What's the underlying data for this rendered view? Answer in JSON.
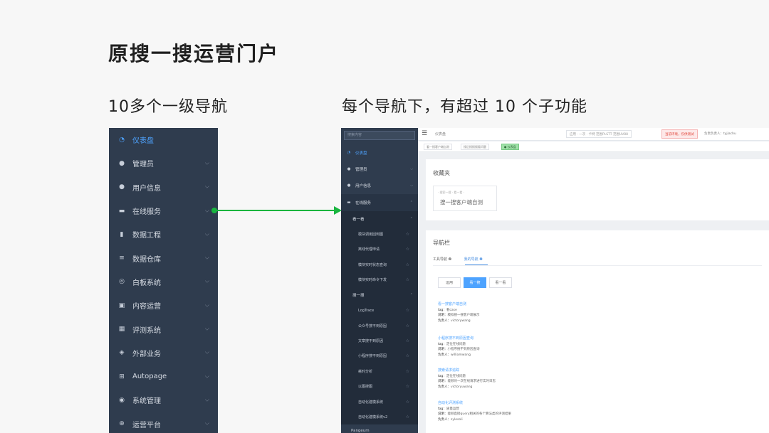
{
  "slide": {
    "title": "原搜一搜运营门户",
    "left_caption": "10多个一级导航",
    "right_caption": "每个导航下，有超过 10 个子功能"
  },
  "big_nav": [
    {
      "label": "仪表盘",
      "icon": "dashboard-icon",
      "glyph": "◔",
      "active": true,
      "chevron": false
    },
    {
      "label": "管理员",
      "icon": "user-icon",
      "glyph": "●",
      "active": false,
      "chevron": true
    },
    {
      "label": "用户信息",
      "icon": "user-icon",
      "glyph": "●",
      "active": false,
      "chevron": true
    },
    {
      "label": "在线服务",
      "icon": "chat-icon",
      "glyph": "▬",
      "active": false,
      "chevron": true
    },
    {
      "label": "数据工程",
      "icon": "document-icon",
      "glyph": "▮",
      "active": false,
      "chevron": true
    },
    {
      "label": "数据仓库",
      "icon": "database-icon",
      "glyph": "≡",
      "active": false,
      "chevron": true
    },
    {
      "label": "白板系统",
      "icon": "gauge-icon",
      "glyph": "◎",
      "active": false,
      "chevron": true
    },
    {
      "label": "内容运营",
      "icon": "robot-icon",
      "glyph": "▣",
      "active": false,
      "chevron": true
    },
    {
      "label": "评测系统",
      "icon": "table-icon",
      "glyph": "▦",
      "active": false,
      "chevron": true
    },
    {
      "label": "外部业务",
      "icon": "shield-icon",
      "glyph": "◈",
      "active": false,
      "chevron": true
    },
    {
      "label": "Autopage",
      "icon": "grid-icon",
      "glyph": "⊞",
      "active": false,
      "chevron": true
    },
    {
      "label": "系统管理",
      "icon": "eye-icon",
      "glyph": "◉",
      "active": false,
      "chevron": true
    },
    {
      "label": "运营平台",
      "icon": "plus-circle-icon",
      "glyph": "⊕",
      "active": false,
      "chevron": true
    }
  ],
  "app": {
    "search_placeholder": "搜索内容",
    "sidebar_top": [
      {
        "label": "仪表盘",
        "icon": "dashboard-icon",
        "glyph": "◔",
        "active": true,
        "chevron": false
      },
      {
        "label": "管理员",
        "icon": "user-icon",
        "glyph": "●",
        "active": false,
        "chevron": true
      },
      {
        "label": "用户信息",
        "icon": "user-icon",
        "glyph": "●",
        "active": false,
        "chevron": true
      },
      {
        "label": "在线服务",
        "icon": "chat-icon",
        "glyph": "▬",
        "active": false,
        "chevron": true
      }
    ],
    "groups": [
      {
        "label": "看一看",
        "items": [
          "模块调用回到图",
          "离线代理申请",
          "模块实时状态查询",
          "模块实时命令下发"
        ]
      },
      {
        "label": "搜一搜",
        "items": [
          "LogTrace",
          "公众号搜不到原因",
          "文章搜不到原因",
          "小程序搜不到原因",
          "耗时分析",
          "以图搜图",
          "自动化建模系统",
          "自动化建模系统v2"
        ]
      }
    ],
    "sidebar_bottom": "Pangeum",
    "topbar": {
      "title": "仪表盘",
      "links": "应用 · 一次 · 卡特    范围PLSTT    范围UV88",
      "warning": "当前环境，仅供测试",
      "user": "负责负责人：tyjiachu"
    },
    "tabs": [
      "看一搜客户端自测",
      "搜后搜搜搜看问题",
      "● 仪表盘"
    ],
    "favorites": {
      "heading": "收藏夹",
      "tagline": "· 搜索一搜 · 看一看 ·",
      "item": "搜一搜客户端自测"
    },
    "navbar": {
      "heading": "导航栏",
      "tabs": [
        "工具导航 ❷",
        "我的导航 ❷"
      ],
      "segments": [
        "运用",
        "看一搜",
        "看一看"
      ],
      "entries": [
        {
          "title": "看一搜客户端自测",
          "tag": "看case",
          "desc": "模拟搜一搜客户端展示",
          "owner": "victorywang"
        },
        {
          "title": "小程序搜不到原因查询",
          "tag": "定位在线问题",
          "desc": "小程序搜不到原因查询",
          "owner": "williamwang"
        },
        {
          "title": "搜索请求追踪",
          "tag": "定位在线问题",
          "desc": "能够对一次在线请求进行实时日志",
          "owner": "victoryuwang"
        },
        {
          "title": "自动化评测系统",
          "tag": "质量运营",
          "desc": "能够直接query相关的各个算法类的评测结果",
          "owner": "sylesoli"
        }
      ],
      "labels": {
        "tag": "tag：",
        "desc": "说明：",
        "owner": "负责人："
      }
    }
  }
}
